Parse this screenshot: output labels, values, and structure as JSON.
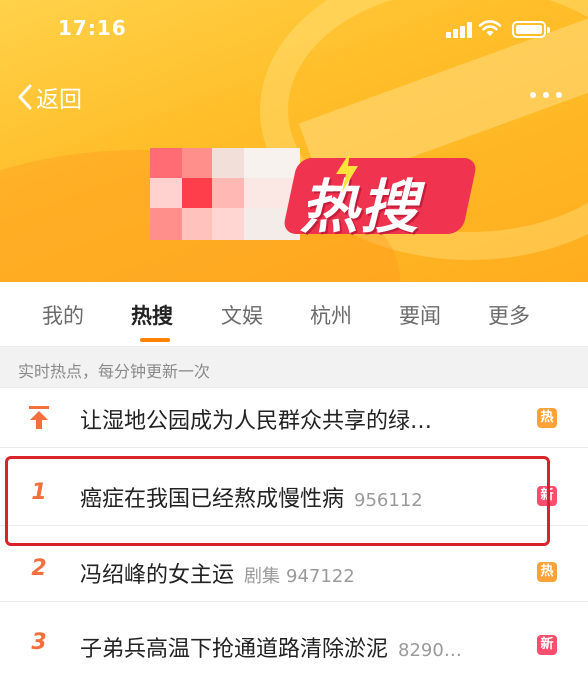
{
  "status_bar": {
    "time": "17:16"
  },
  "nav": {
    "back_label": "返回"
  },
  "banner": {
    "title": "热搜"
  },
  "tabs": [
    {
      "label": "我的",
      "active": false
    },
    {
      "label": "热搜",
      "active": true
    },
    {
      "label": "文娱",
      "active": false
    },
    {
      "label": "杭州",
      "active": false
    },
    {
      "label": "要闻",
      "active": false
    },
    {
      "label": "更多",
      "active": false
    }
  ],
  "subheader": "实时热点，每分钟更新一次",
  "list": [
    {
      "rank": "",
      "rank_icon": "pin-up-icon",
      "title": "让湿地公园成为人民群众共享的绿…",
      "category": "",
      "count": "",
      "badge": "热",
      "badge_type": "hot"
    },
    {
      "rank": "1",
      "title": "癌症在我国已经熬成慢性病",
      "category": "",
      "count": "956112",
      "badge": "新",
      "badge_type": "new"
    },
    {
      "rank": "2",
      "title": "冯绍峰的女主运",
      "category": "剧集",
      "count": "947122",
      "badge": "热",
      "badge_type": "hot"
    },
    {
      "rank": "3",
      "title": "子弟兵高温下抢通道路清除淤泥",
      "category": "",
      "count": "8290…",
      "badge": "新",
      "badge_type": "new"
    }
  ],
  "colors": {
    "accent": "#ff8200",
    "rank": "#f36f3c",
    "hot_badge": "#ffa238",
    "new_badge": "#ff4d6d",
    "highlight": "#d9232a"
  }
}
